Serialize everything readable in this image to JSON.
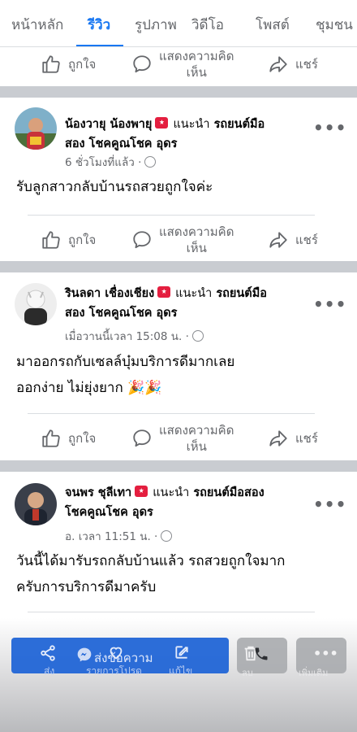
{
  "tabs": [
    {
      "label": "หน้าหลัก",
      "active": false
    },
    {
      "label": "รีวิว",
      "active": true
    },
    {
      "label": "รูปภาพ",
      "active": false
    },
    {
      "label": "วิดีโอ",
      "active": false
    },
    {
      "label": "โพสต์",
      "active": false
    },
    {
      "label": "ชุมชน",
      "active": false
    }
  ],
  "actions": {
    "like": "ถูกใจ",
    "comment_line1": "แสดงความคิด",
    "comment_line2": "เห็น",
    "share": "แชร์"
  },
  "recommends": "แนะนำ",
  "reviews": [
    {
      "name": "น้องวายุ น้องพายุ",
      "page_line1": "รถยนต์มือ",
      "page_line2": "สอง โชคคูณโชค อุดร",
      "time": "6 ชั่วโมงที่แล้ว ·",
      "text_lines": [
        "รับลูกสาวกลับบ้านรถสวยถูกใจค่ะ"
      ]
    },
    {
      "name": "รินลดา เชื่องเชียง",
      "page_line1": "รถยนต์มือ",
      "page_line2": "สอง โชคคูณโชค อุดร",
      "time": "เมื่อวานนี้เวลา 15:08 น. ·",
      "text_lines": [
        "มาออกรถกับเซลล์บุ๋มบริการดีมากเลย",
        "ออกง่าย ไม่ยุ่งยาก 🎉🎉"
      ]
    },
    {
      "name": "จนพร ชุลีเทา",
      "page_line1": "รถยนต์มือสอง",
      "page_line2": "โชคคูณโชค อุดร",
      "time": "อ. เวลา 11:51 น. ·",
      "text_lines": [
        "วันนี้ได้มารับรถกลับบ้านแล้ว รถสวยถูกใจมาก",
        "ครับการบริการดีมาครับ"
      ]
    }
  ],
  "bottom_bar": {
    "send_message": "ส่งข้อความ",
    "share_short": "ส่ง",
    "favorites": "รายการโปรด",
    "edit": "แก้ไข",
    "delete": "ลบ",
    "more": "เพิ่มเติม"
  },
  "colors": {
    "accent": "#1877f2",
    "badge": "#e41e3f",
    "separator": "#c9ccd1"
  }
}
